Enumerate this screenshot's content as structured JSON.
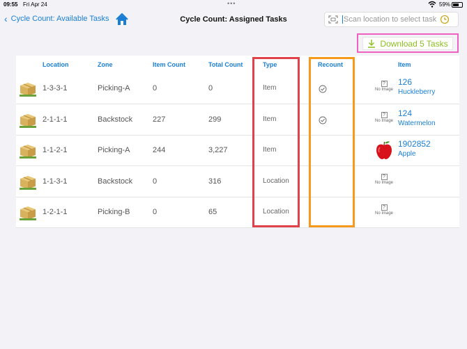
{
  "status_bar": {
    "time": "09:55",
    "date": "Fri Apr 24",
    "dots": "•••",
    "battery_pct": "59%"
  },
  "nav": {
    "back_label": "Cycle Count: Available Tasks",
    "title": "Cycle Count: Assigned Tasks",
    "search_placeholder": "Scan location to select task"
  },
  "download_label": "Download 5 Tasks",
  "table": {
    "headers": {
      "location": "Location",
      "zone": "Zone",
      "item_count": "Item Count",
      "total_count": "Total Count",
      "type": "Type",
      "recount": "Recount",
      "item": "Item"
    },
    "rows": [
      {
        "location": "1-3-3-1",
        "zone": "Picking-A",
        "item_count": "0",
        "total_count": "0",
        "type": "Item",
        "recount": true,
        "item_image": "no-image",
        "no_image_label": "No Image",
        "item_number": "126",
        "item_name": "Huckleberry"
      },
      {
        "location": "2-1-1-1",
        "zone": "Backstock",
        "item_count": "227",
        "total_count": "299",
        "type": "Item",
        "recount": true,
        "item_image": "no-image",
        "no_image_label": "No Image",
        "item_number": "124",
        "item_name": "Watermelon"
      },
      {
        "location": "1-1-2-1",
        "zone": "Picking-A",
        "item_count": "244",
        "total_count": "3,227",
        "type": "Item",
        "recount": false,
        "item_image": "apple",
        "no_image_label": "",
        "item_number": "1902852",
        "item_name": "Apple"
      },
      {
        "location": "1-1-3-1",
        "zone": "Backstock",
        "item_count": "0",
        "total_count": "316",
        "type": "Location",
        "recount": false,
        "item_image": "no-image",
        "no_image_label": "No Image",
        "item_number": "",
        "item_name": ""
      },
      {
        "location": "1-2-1-1",
        "zone": "Picking-B",
        "item_count": "0",
        "total_count": "65",
        "type": "Location",
        "recount": false,
        "item_image": "no-image",
        "no_image_label": "No Image",
        "item_number": "",
        "item_name": ""
      }
    ]
  },
  "colors": {
    "accent": "#1a7fd4",
    "download_text": "#8cbf1e",
    "highlight_download": "#ef5fbf",
    "highlight_type": "#e0424b",
    "highlight_recount": "#f59a1d"
  }
}
